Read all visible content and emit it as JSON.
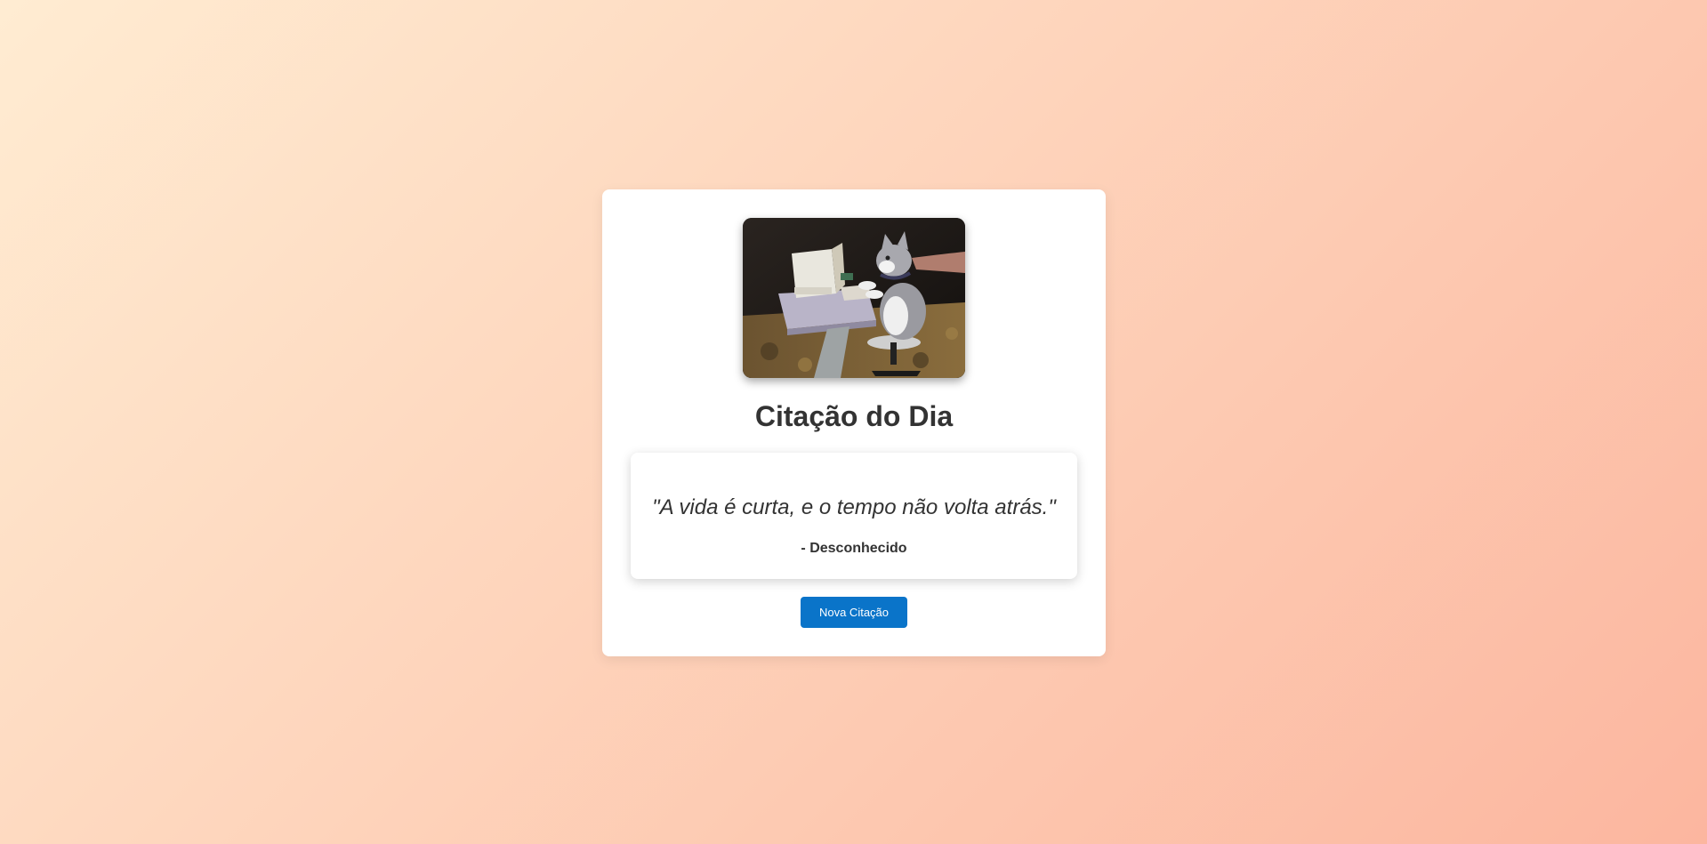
{
  "card": {
    "image": {
      "icon": "cat-at-computer-photo"
    },
    "title": "Citação do Dia",
    "quote": {
      "text": "\"A vida é curta, e o tempo não volta atrás.\"",
      "author": "- Desconhecido"
    },
    "new_quote_button": "Nova Citação"
  },
  "colors": {
    "background_start": "#ffecd2",
    "background_end": "#fcb69f",
    "button": "#0a74c9",
    "text": "#333333"
  }
}
